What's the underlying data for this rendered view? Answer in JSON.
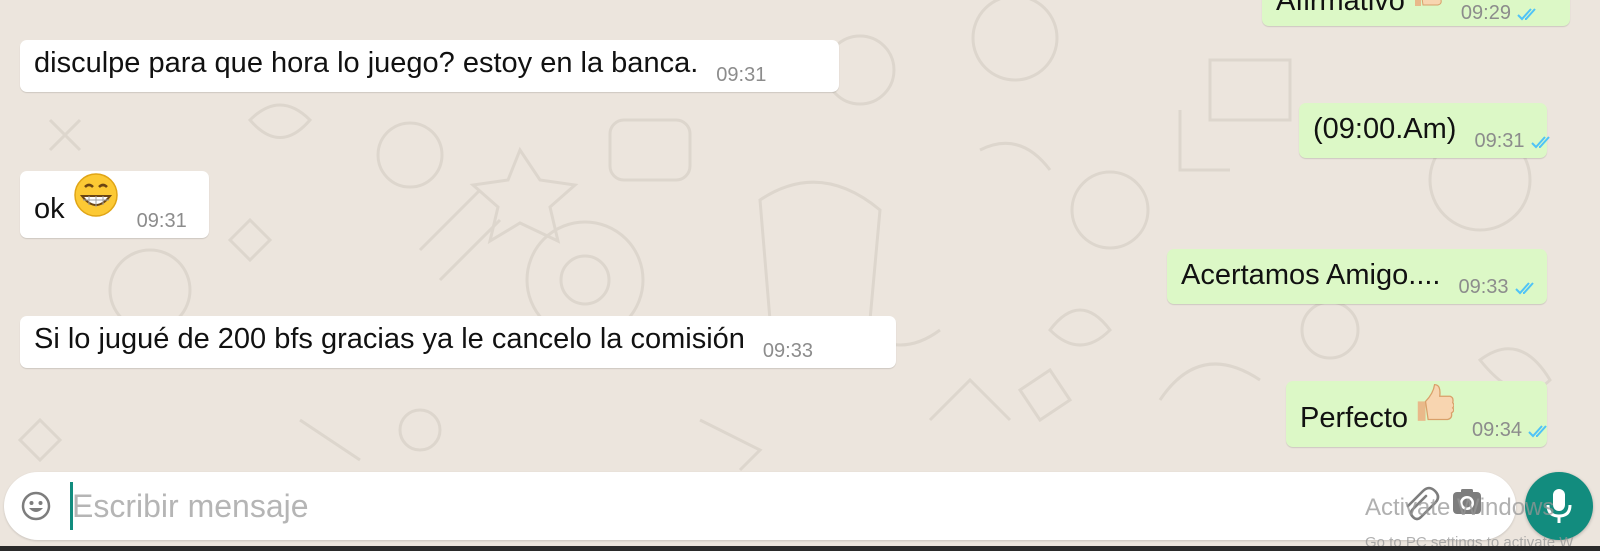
{
  "composer": {
    "placeholder": "Escribir mensaje",
    "emoji_icon": "smiley-icon",
    "attach_icon": "paperclip-icon",
    "camera_icon": "camera-icon",
    "mic_icon": "microphone-icon"
  },
  "messages": [
    {
      "direction": "outgoing",
      "text": "Afirmativo",
      "emoji": "thumbs-up",
      "time": "09:29",
      "status": "read"
    },
    {
      "direction": "incoming",
      "text": "disculpe para que hora lo juego? estoy en la banca.",
      "time": "09:31"
    },
    {
      "direction": "outgoing",
      "text": "(09:00.Am)",
      "time": "09:31",
      "status": "read"
    },
    {
      "direction": "incoming",
      "text": "ok",
      "emoji": "grinning-face",
      "time": "09:31"
    },
    {
      "direction": "outgoing",
      "text": "Acertamos Amigo....",
      "time": "09:33",
      "status": "read"
    },
    {
      "direction": "incoming",
      "text": "Si lo jugué de 200 bfs gracias ya le cancelo la comisión",
      "time": "09:33"
    },
    {
      "direction": "outgoing",
      "text": "Perfecto",
      "emoji": "thumbs-up",
      "time": "09:34",
      "status": "read"
    }
  ],
  "watermark": {
    "line1": "Activate Windows",
    "line2": "Go to PC settings to activate W"
  },
  "colors": {
    "chat_background": "#ece5dd",
    "incoming_bubble": "#ffffff",
    "outgoing_bubble": "#dcf8c6",
    "accent": "#128c7e",
    "read_ticks": "#4fc3f7"
  }
}
